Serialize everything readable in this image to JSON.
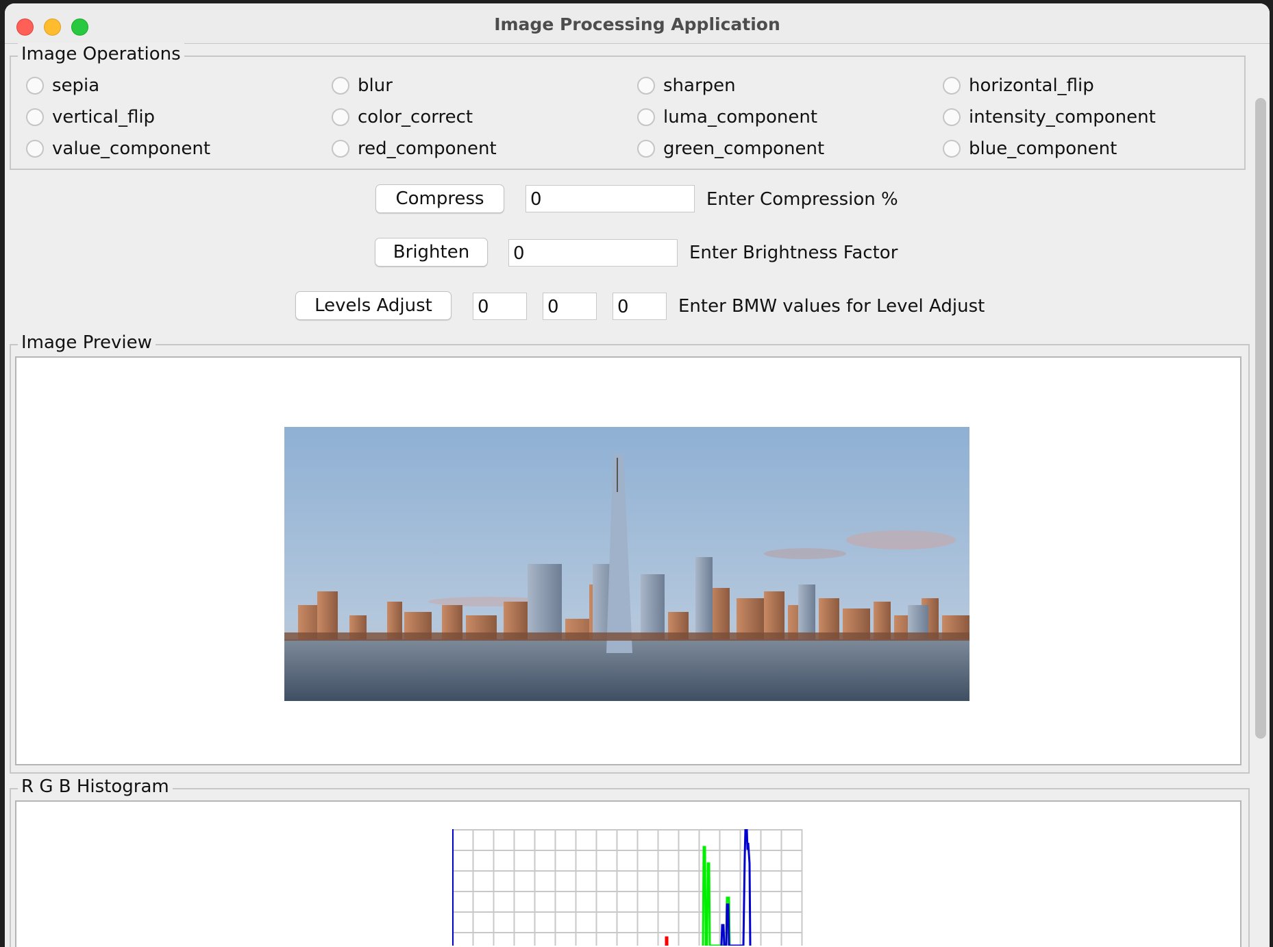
{
  "window": {
    "title": "Image Processing Application"
  },
  "operations": {
    "legend": "Image Operations",
    "items": [
      {
        "label": "sepia"
      },
      {
        "label": "blur"
      },
      {
        "label": "sharpen"
      },
      {
        "label": "horizontal_flip"
      },
      {
        "label": "vertical_flip"
      },
      {
        "label": "color_correct"
      },
      {
        "label": "luma_component"
      },
      {
        "label": "intensity_component"
      },
      {
        "label": "value_component"
      },
      {
        "label": "red_component"
      },
      {
        "label": "green_component"
      },
      {
        "label": "blue_component"
      }
    ]
  },
  "compress": {
    "button": "Compress",
    "value": "0",
    "hint": "Enter Compression %"
  },
  "brighten": {
    "button": "Brighten",
    "value": "0",
    "hint": "Enter Brightness Factor"
  },
  "levels": {
    "button": "Levels Adjust",
    "black": "0",
    "mid": "0",
    "white": "0",
    "hint": "Enter BMW values for Level Adjust"
  },
  "preview": {
    "legend": "Image Preview"
  },
  "histogram": {
    "legend": "R G B Histogram"
  },
  "colors": {
    "red": "#ff0000",
    "green": "#00ee00",
    "blue": "#0000cc",
    "grid": "#c8c8c8"
  }
}
